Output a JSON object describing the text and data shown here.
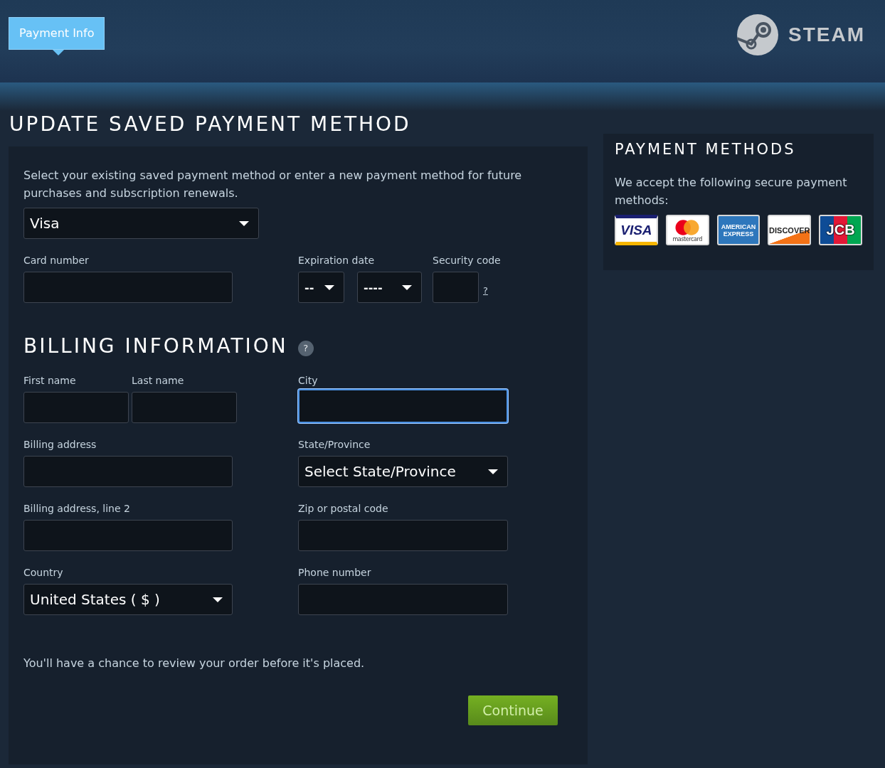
{
  "header": {
    "tab": "Payment Info",
    "logo_text": "STEAM"
  },
  "title": "UPDATE SAVED PAYMENT METHOD",
  "form": {
    "intro": "Select your existing saved payment method or enter a new payment method for future purchases and subscription renewals.",
    "saved_method": "Visa",
    "card_number": {
      "label": "Card number",
      "focused": false
    },
    "expiration": {
      "label": "Expiration date",
      "month": "--",
      "year": "----"
    },
    "security": {
      "label": "Security code",
      "help": "?",
      "focused": false
    },
    "billing_heading": "BILLING INFORMATION",
    "billing_help": "?",
    "first_name": {
      "label": "First name",
      "focused": false
    },
    "last_name": {
      "label": "Last name",
      "focused": false
    },
    "city": {
      "label": "City",
      "focused": true
    },
    "billing_address": {
      "label": "Billing address",
      "focused": false
    },
    "state": {
      "label": "State/Province",
      "value": "Select State/Province"
    },
    "billing_address_2": {
      "label": "Billing address, line 2",
      "focused": false
    },
    "zip": {
      "label": "Zip or postal code",
      "focused": false
    },
    "country": {
      "label": "Country",
      "value": "United States ( $ )"
    },
    "phone": {
      "label": "Phone number",
      "focused": false
    },
    "note": "You'll have a chance to review your order before it's placed.",
    "continue": "Continue"
  },
  "payment_methods": {
    "heading": "PAYMENT METHODS",
    "text": "We accept the following secure payment methods:",
    "cards": [
      {
        "kind": "visa",
        "label": "VISA"
      },
      {
        "kind": "mastercard",
        "label": "mastercard"
      },
      {
        "kind": "amex",
        "label": "AMERICAN EXPRESS"
      },
      {
        "kind": "discover",
        "label": "DISCOVER"
      },
      {
        "kind": "jcb",
        "label": "JCB"
      }
    ]
  }
}
